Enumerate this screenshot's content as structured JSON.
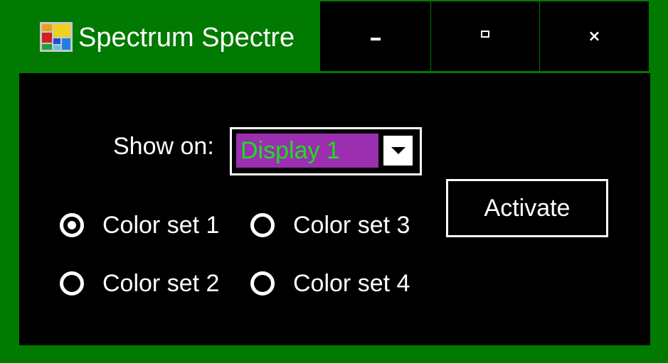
{
  "window": {
    "title": "Spectrum Spectre",
    "icon": "app-grid-icon",
    "minimize_glyph": "minimize-icon",
    "maximize_glyph": "maximize-icon",
    "close_label": "×"
  },
  "form": {
    "show_on_label": "Show on:",
    "display_select": {
      "value": "Display 1"
    },
    "activate_label": "Activate",
    "color_sets": [
      {
        "label": "Color set 1",
        "selected": true
      },
      {
        "label": "Color set 2",
        "selected": false
      },
      {
        "label": "Color set 3",
        "selected": false
      },
      {
        "label": "Color set 4",
        "selected": false
      }
    ]
  },
  "colors": {
    "frame": "#007a00",
    "client_background": "#000000",
    "select_background": "#9b2fb0",
    "select_text": "#19e21a",
    "text": "#ffffff"
  }
}
